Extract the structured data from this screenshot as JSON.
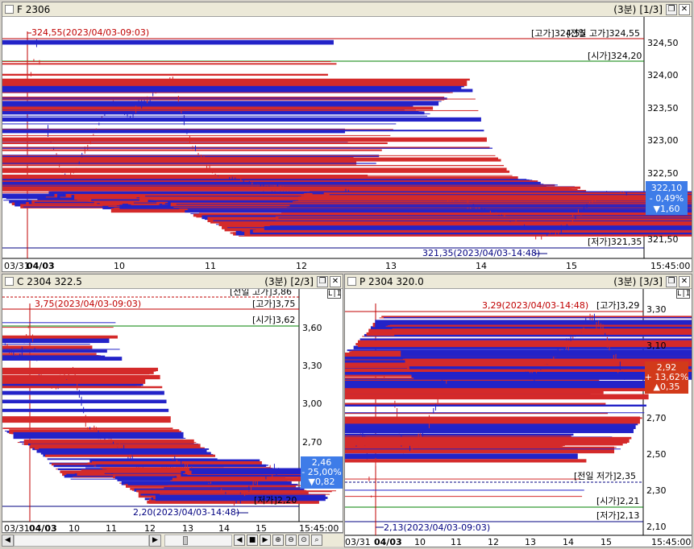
{
  "colors": {
    "up": "#d42a2a",
    "down": "#2323c8",
    "high_line": "#c00000",
    "open_line": "#008000",
    "low_line": "#000080",
    "badge_down": "#3e7ce8",
    "badge_up": "#d23a1a"
  },
  "panes": {
    "top": {
      "title": "F 2306",
      "period": "(3분)",
      "page": "[1/3]",
      "y_ticks": [
        "324,50",
        "324,00",
        "323,50",
        "323,00",
        "322,50",
        "321,50"
      ],
      "x_ticks": [
        "03/31",
        "04/03",
        "10",
        "11",
        "12",
        "13",
        "14",
        "15",
        "15:45:00"
      ],
      "high_annotation": "324,55(2023/04/03-09:03)",
      "low_annotation": "321,35(2023/04/03-14:48)",
      "label_high": "[고가]324,55",
      "label_prev_high": "[전일 고가]324,55",
      "label_open": "[시가]324,20",
      "label_low": "[저가]321,35",
      "badge": {
        "price": "322,10",
        "pct": "- 0,49%",
        "chg": "▼1,60"
      }
    },
    "call": {
      "title": "C 2304 322.5",
      "period": "(3분)",
      "page": "[2/3]",
      "y_ticks": [
        "3,60",
        "3,30",
        "3,00",
        "2,70",
        "2,40"
      ],
      "x_ticks": [
        "03/31",
        "04/03",
        "10",
        "11",
        "12",
        "13",
        "14",
        "15",
        "15:45:00"
      ],
      "high_annotation": "3,75(2023/04/03-09:03)",
      "low_annotation": "2,20(2023/04/03-14:48)",
      "label_prev_high": "[전일 고가]3,86",
      "label_high": "[고가]3,75",
      "label_open": "[시가]3,62",
      "label_low": "[저가]2,20",
      "badge": {
        "price": "2,46",
        "pct": "- 25,00%",
        "chg": "▼0,82"
      }
    },
    "put": {
      "title": "P 2304 320.0",
      "period": "(3분)",
      "page": "[3/3]",
      "y_ticks": [
        "3,30",
        "3,10",
        "2,90",
        "2,70",
        "2,50",
        "2,30",
        "2,10"
      ],
      "x_ticks": [
        "03/31",
        "04/03",
        "10",
        "11",
        "12",
        "13",
        "14",
        "15",
        "15:45:00"
      ],
      "high_annotation": "3,29(2023/04/03-14:48)",
      "low_annotation": "2,13(2023/04/03-09:03)",
      "label_high": "[고가]3,29",
      "label_prev_low": "[전일 저가]2,35",
      "label_open": "[시가]2,21",
      "label_low": "[저가]2,13",
      "badge": {
        "price": "2,92",
        "pct": "+ 13,62%",
        "chg": "▲0,35"
      }
    }
  },
  "lbtn": "L|I"
}
